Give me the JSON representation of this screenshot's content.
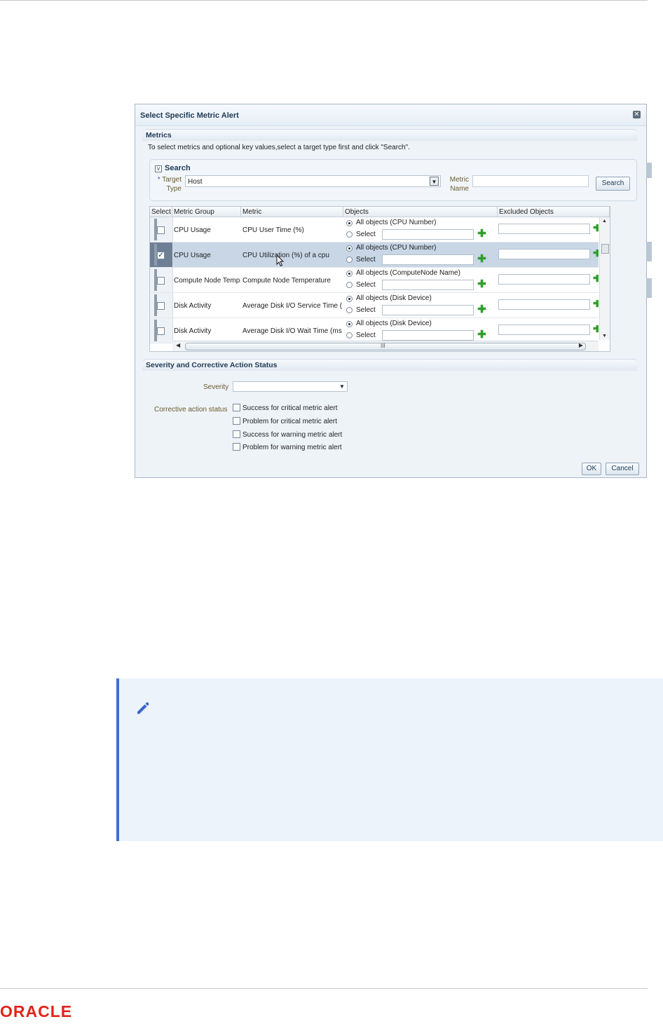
{
  "dialog": {
    "title": "Select Specific Metric Alert",
    "close_glyph": "✕",
    "metrics_section": "Metrics",
    "instruction": "To select metrics and optional key values,select a target type first and click \"Search\".",
    "search": {
      "title": "Search",
      "toggle_glyph": "v",
      "required_mark": "*",
      "target_type_label_1": "Target",
      "target_type_label_2": "Type",
      "target_type_value": "Host",
      "metric_name_label_1": "Metric",
      "metric_name_label_2": "Name",
      "metric_name_value": "",
      "button": "Search"
    },
    "table": {
      "headers": [
        "Select",
        "Metric Group",
        "Metric",
        "Objects",
        "Excluded Objects"
      ],
      "rows": [
        {
          "checked": false,
          "group": "CPU Usage",
          "metric": "CPU User Time (%)",
          "all_objects": "All objects (CPU Number)",
          "select": "Select"
        },
        {
          "checked": true,
          "group": "CPU Usage",
          "metric": "CPU Utilization (%) of a cpu",
          "all_objects": "All objects (CPU Number)",
          "select": "Select"
        },
        {
          "checked": false,
          "group": "Compute Node Temperature",
          "metric": "Compute Node Temperature",
          "all_objects": "All objects (ComputeNode Name)",
          "select": "Select"
        },
        {
          "checked": false,
          "group": "Disk Activity",
          "metric": "Average Disk I/O Service Time (ms)",
          "all_objects": "All objects (Disk Device)",
          "select": "Select"
        },
        {
          "checked": false,
          "group": "Disk Activity",
          "metric": "Average Disk I/O Wait Time (ms)",
          "all_objects": "All objects (Disk Device)",
          "select": "Select"
        }
      ],
      "hscroll_grip": "III"
    },
    "severity_section": "Severity and Corrective Action Status",
    "severity_label": "Severity",
    "severity_value": "",
    "corrective_label": "Corrective action status",
    "corrective_options": [
      "Success for critical metric alert",
      "Problem for critical metric alert",
      "Success for warning metric alert",
      "Problem for warning metric alert"
    ],
    "ok_button": "OK",
    "cancel_button": "Cancel"
  },
  "footer": {
    "logo_text": "ORACLE",
    "logo_color": "#e2231a"
  },
  "colors": {
    "note_background": "#edf3fb",
    "note_accent": "#3c6fd0",
    "plus_green": "#2ea02a"
  }
}
